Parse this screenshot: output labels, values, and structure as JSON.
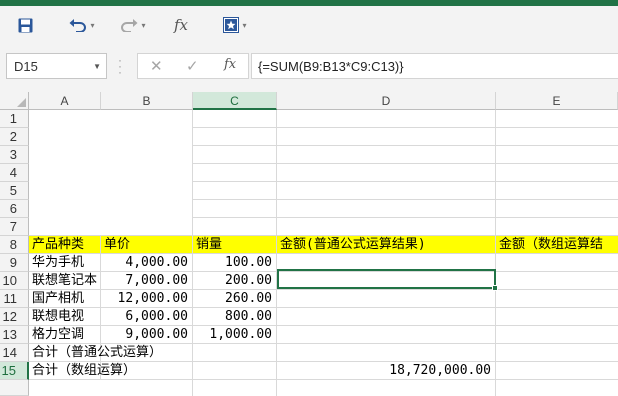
{
  "toolbar": {
    "save_icon": "save-icon",
    "undo_icon": "undo-icon",
    "redo_icon": "redo-icon",
    "fx_label": "fx",
    "form_icon": "form-icon"
  },
  "formula_bar": {
    "name_box": "D15",
    "cancel_glyph": "✕",
    "enter_glyph": "✓",
    "fx_label": "fx",
    "formula": "{=SUM(B9:B13*C9:C13)}"
  },
  "columns": [
    "A",
    "B",
    "C",
    "D",
    "E"
  ],
  "selected_column": "C",
  "rows": [
    "1",
    "2",
    "3",
    "4",
    "5",
    "6",
    "7",
    "8",
    "9",
    "10",
    "11",
    "12",
    "13",
    "14",
    "15"
  ],
  "selected_row": "15",
  "sheet": {
    "headers": {
      "a8": "产品种类",
      "b8": "单价",
      "c8": "销量",
      "d8": "金额(普通公式运算结果)",
      "e8": "金额（数组运算结"
    },
    "data": [
      {
        "name": "华为手机",
        "price": "4,000.00",
        "qty": "100.00"
      },
      {
        "name": "联想笔记本",
        "price": "7,000.00",
        "qty": "200.00"
      },
      {
        "name": "国产相机",
        "price": "12,000.00",
        "qty": "260.00"
      },
      {
        "name": "联想电视",
        "price": "6,000.00",
        "qty": "800.00"
      },
      {
        "name": "格力空调",
        "price": "9,000.00",
        "qty": "1,000.00"
      }
    ],
    "a14": "合计（普通公式运算）",
    "a15": "合计（数组运算）",
    "d15": "18,720,000.00"
  },
  "colors": {
    "accent": "#217346",
    "header_highlight": "#ffff00",
    "selected_header_bg": "#d2e8da"
  }
}
